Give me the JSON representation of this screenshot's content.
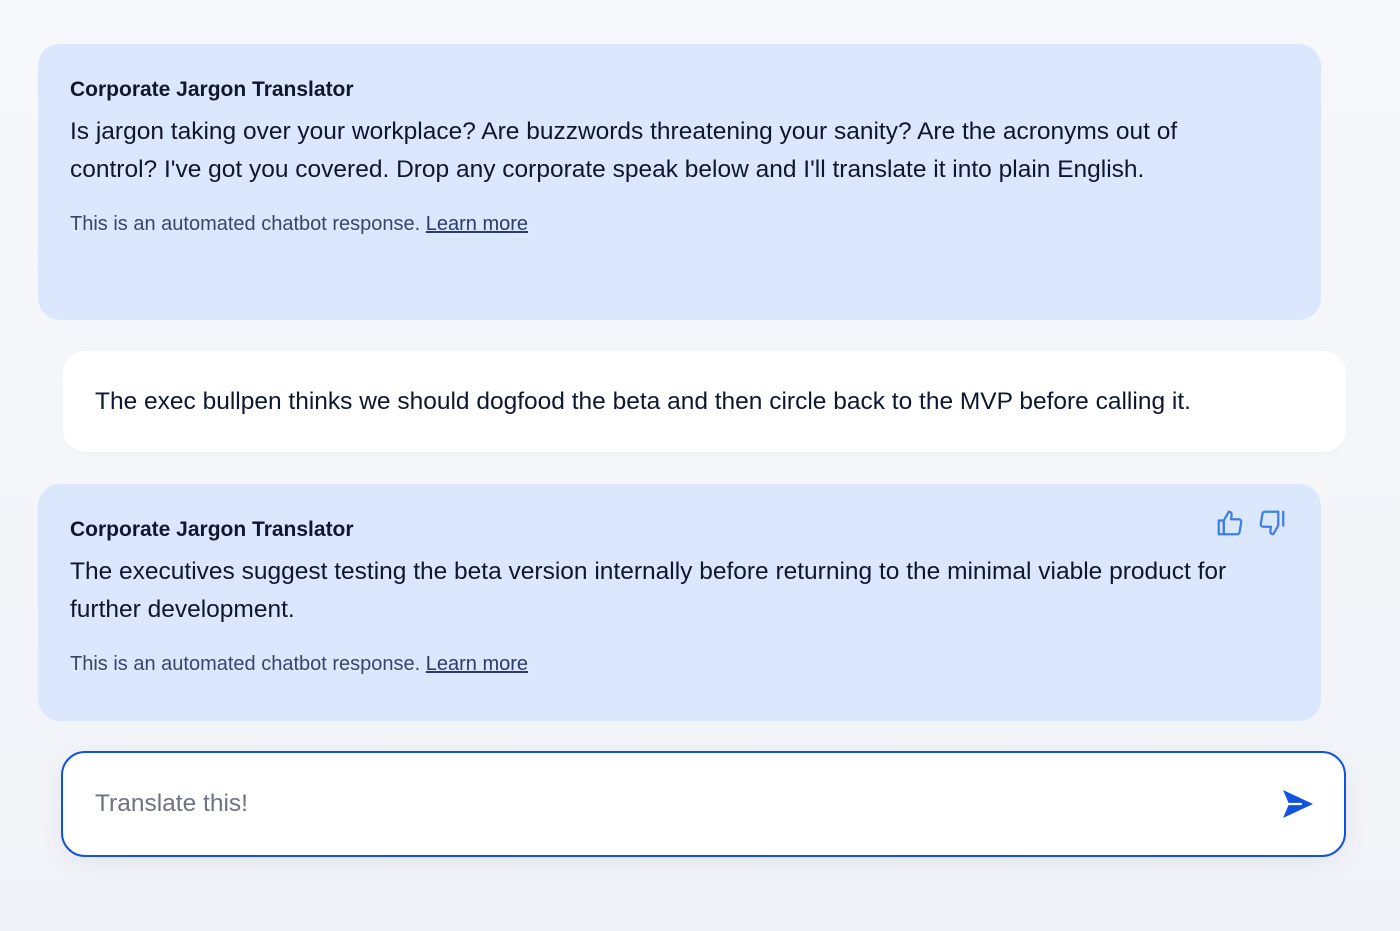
{
  "conversation": {
    "welcome": {
      "sender": "Corporate Jargon Translator",
      "text": "Is jargon taking over your workplace? Are buzzwords threatening your sanity? Are the acronyms out of control? I've got you covered. Drop any corporate speak below and I'll translate it into plain English.",
      "disclaimer": "This is an automated chatbot response.",
      "learn_more": "Learn more"
    },
    "user_message": {
      "text": "The exec bullpen thinks we should dogfood the beta and then circle back to the MVP before calling it."
    },
    "reply": {
      "sender": "Corporate Jargon Translator",
      "text": "The executives suggest testing the beta version internally before returning to the minimal viable product for further development.",
      "disclaimer": "This is an automated chatbot response.",
      "learn_more": "Learn more",
      "feedback_icons": [
        "thumbs-up-icon",
        "thumbs-down-icon"
      ]
    }
  },
  "composer": {
    "placeholder": "Translate this!",
    "value": "",
    "send_icon": "send-icon"
  },
  "colors": {
    "bot_bubble": "#dbe7fd",
    "user_bubble": "#ffffff",
    "accent": "#1252e0",
    "feedback_icon": "#3d7fe6"
  }
}
